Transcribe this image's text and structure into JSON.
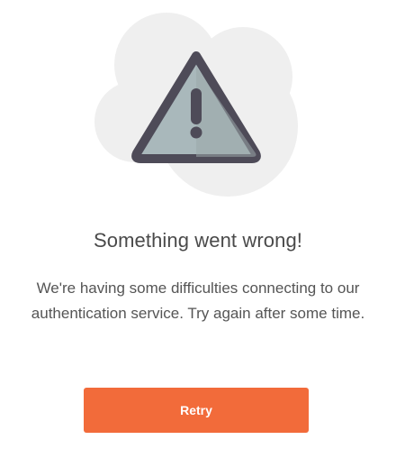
{
  "illustration": {
    "icon": "warning-triangle-icon",
    "cloud_color": "#efefef",
    "triangle_stroke": "#4e4b58",
    "triangle_fill": "#a9b8bb",
    "triangle_fill_shade": "#9aa7a9"
  },
  "error": {
    "title": "Something went wrong!",
    "message": "We're having some difficulties connecting to our authentication service. Try again after some time."
  },
  "actions": {
    "retry_label": "Retry",
    "retry_color": "#f26b3a"
  }
}
